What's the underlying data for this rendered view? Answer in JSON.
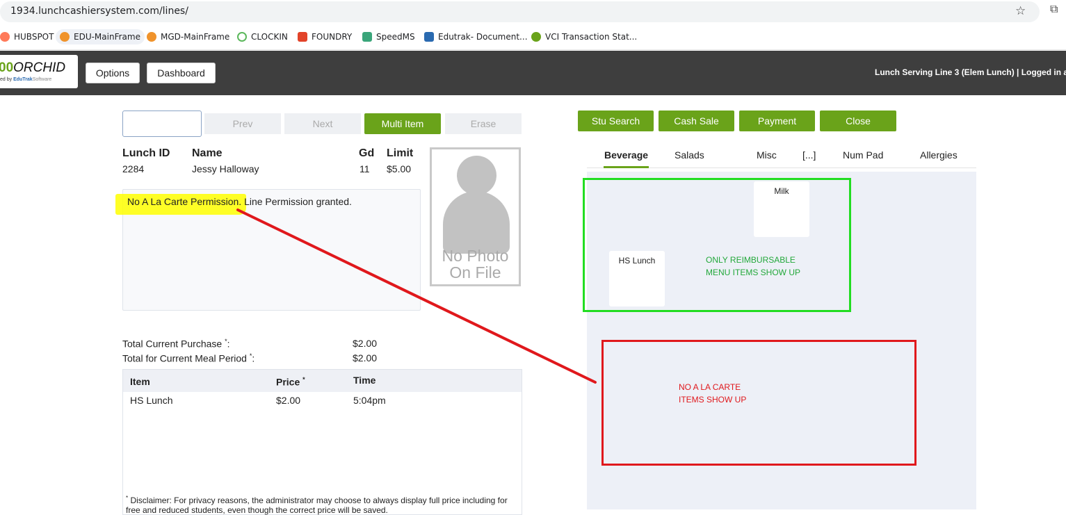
{
  "browser": {
    "url": "1934.lunchcashiersystem.com/lines/",
    "bookmarks": [
      {
        "label": "HUBSPOT",
        "color": "#ff7a59"
      },
      {
        "label": "EDU-MainFrame",
        "color": "#f0932b"
      },
      {
        "label": "MGD-MainFrame",
        "color": "#f0932b"
      },
      {
        "label": "CLOCKIN",
        "color": "#5cb85c"
      },
      {
        "label": "FOUNDRY",
        "color": "#e24329"
      },
      {
        "label": "SpeedMS",
        "color": "#3aa57a"
      },
      {
        "label": "Edutrak- Document...",
        "color": "#2a6ab0"
      },
      {
        "label": "VCI Transaction Stat...",
        "color": "#6aa31a"
      }
    ]
  },
  "header": {
    "logo_num": "00",
    "logo_name": "ORCHID",
    "logo_sub_prefix": "ed by",
    "logo_brand": "EduTrak",
    "logo_software": "Software",
    "options_label": "Options",
    "dashboard_label": "Dashboard",
    "status": "Lunch Serving Line 3 (Elem Lunch) | Logged in a"
  },
  "nav_buttons": {
    "prev": "Prev",
    "next": "Next",
    "multi_item": "Multi Item",
    "erase": "Erase"
  },
  "student": {
    "headers": {
      "lunch_id": "Lunch ID",
      "name": "Name",
      "grade": "Gd",
      "limit": "Limit"
    },
    "lunch_id": "2284",
    "name": "Jessy Halloway",
    "grade": "11",
    "limit": "$5.00",
    "photo_line1": "No Photo",
    "photo_line2": "On File",
    "permission": "No A La Carte Permission. Line Permission granted."
  },
  "totals": {
    "current_purchase_label": "Total Current Purchase",
    "current_purchase_value": "$2.00",
    "meal_period_label": "Total for Current Meal Period",
    "meal_period_value": "$2.00",
    "asterisk": "*",
    "colon": ":"
  },
  "purchases": {
    "columns": {
      "item": "Item",
      "price": "Price",
      "time": "Time"
    },
    "rows": [
      {
        "item": "HS Lunch",
        "price": "$2.00",
        "time": "5:04pm"
      }
    ],
    "disclaimer": "Disclaimer: For privacy reasons, the administrator may choose to always display full price including for free and reduced students, even though the correct price will be saved."
  },
  "actions": {
    "stu_search": "Stu Search",
    "cash_sale": "Cash Sale",
    "payment": "Payment",
    "close": "Close"
  },
  "tabs": [
    "Beverage",
    "Salads",
    "Misc",
    "[...]",
    "Num Pad",
    "Allergies"
  ],
  "menu_tiles": {
    "milk": "Milk",
    "hs_lunch": "HS Lunch"
  },
  "annotations": {
    "green_line1": "ONLY REIMBURSABLE",
    "green_line2": "MENU ITEMS SHOW UP",
    "red_line1": "NO A LA CARTE",
    "red_line2": "ITEMS SHOW UP",
    "green_color": "#22dd22",
    "red_color": "#e0181c",
    "highlight_color": "#ffff00"
  },
  "colors": {
    "accent_green": "#6aa31a",
    "header_bg": "#3e3e3e"
  }
}
